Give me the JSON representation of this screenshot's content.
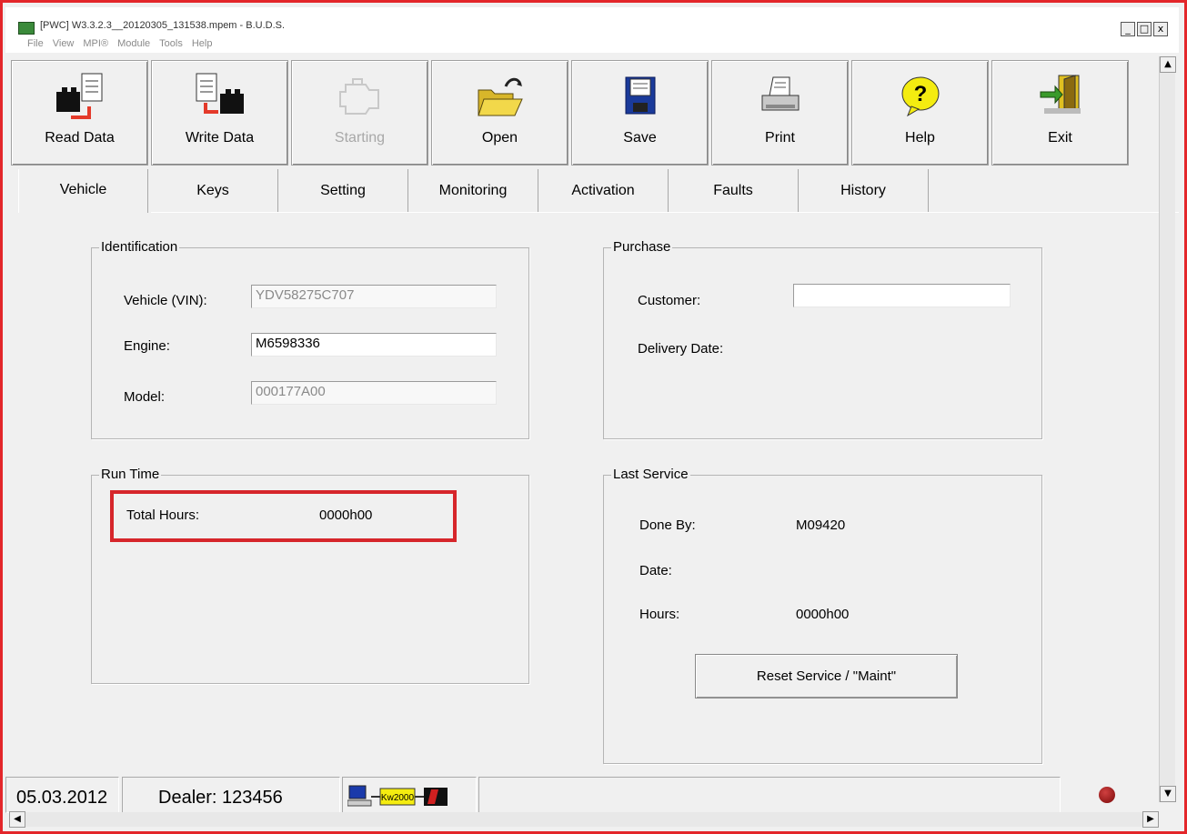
{
  "window": {
    "title": "[PWC] W3.3.2.3__20120305_131538.mpem - B.U.D.S.",
    "controls": [
      "_",
      "□",
      "x"
    ]
  },
  "menu": [
    "File",
    "View",
    "MPI®",
    "Module",
    "Tools",
    "Help"
  ],
  "toolbar": {
    "buttons": [
      {
        "label": "Read Data",
        "icon": "read-data-icon"
      },
      {
        "label": "Write Data",
        "icon": "write-data-icon"
      },
      {
        "label": "Starting",
        "icon": "engine-icon",
        "disabled": true
      },
      {
        "label": "Open",
        "icon": "folder-open-icon"
      },
      {
        "label": "Save",
        "icon": "floppy-disk-icon"
      },
      {
        "label": "Print",
        "icon": "printer-icon"
      },
      {
        "label": "Help",
        "icon": "help-bubble-icon"
      },
      {
        "label": "Exit",
        "icon": "exit-door-icon"
      }
    ]
  },
  "tabs": [
    "Vehicle",
    "Keys",
    "Setting",
    "Monitoring",
    "Activation",
    "Faults",
    "History"
  ],
  "active_tab": "Vehicle",
  "identification": {
    "caption": "Identification",
    "vin_label": "Vehicle (VIN):",
    "vin_value": "YDV58275C707",
    "engine_label": "Engine:",
    "engine_value": "M6598336",
    "model_label": "Model:",
    "model_value": "000177A00"
  },
  "purchase": {
    "caption": "Purchase",
    "customer_label": "Customer:",
    "customer_value": "",
    "delivery_label": "Delivery Date:"
  },
  "runtime": {
    "caption": "Run Time",
    "total_label": "Total Hours:",
    "total_value": "0000h00"
  },
  "last_service": {
    "caption": "Last Service",
    "done_by_label": "Done By:",
    "done_by_value": "M09420",
    "date_label": "Date:",
    "hours_label": "Hours:",
    "hours_value": "0000h00",
    "reset_label": "Reset Service / \"Maint\""
  },
  "status": {
    "date": "05.03.2012",
    "dealer": "Dealer: 123456",
    "kw_label": "Kw2000"
  },
  "colors": {
    "highlight": "#d6262b",
    "frame": "#e3262a"
  }
}
